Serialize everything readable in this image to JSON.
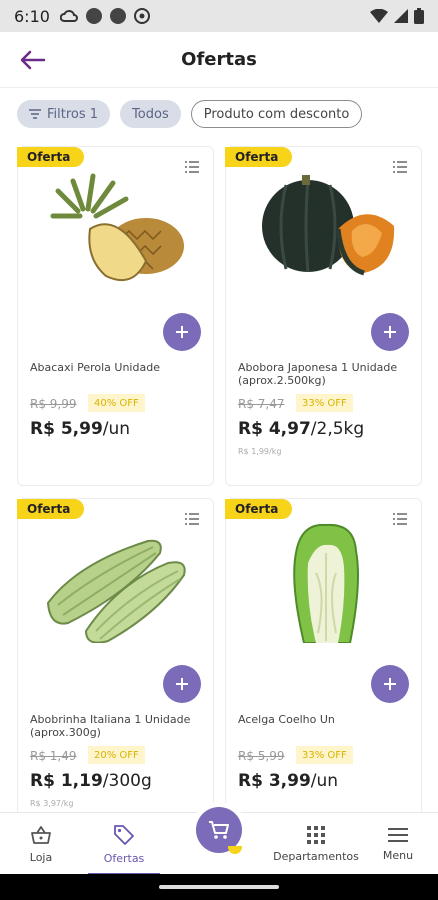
{
  "status_bar": {
    "time": "6:10"
  },
  "header": {
    "title": "Ofertas"
  },
  "filters": [
    {
      "label": "Filtros 1",
      "style": "filled"
    },
    {
      "label": "Todos",
      "style": "filled"
    },
    {
      "label": "Produto com desconto",
      "style": "outline"
    }
  ],
  "products": [
    {
      "badge": "Oferta",
      "name": "Abacaxi Perola Unidade",
      "old_price": "R$ 9,99",
      "discount": "40% OFF",
      "price": "R$ 5,99",
      "unit": "/un",
      "unit_price": ""
    },
    {
      "badge": "Oferta",
      "name": "Abobora Japonesa 1 Unidade (aprox.2.500kg)",
      "old_price": "R$ 7,47",
      "discount": "33% OFF",
      "price": "R$ 4,97",
      "unit": "/2,5kg",
      "unit_price": "R$ 1,99/kg"
    },
    {
      "badge": "Oferta",
      "name": "Abobrinha Italiana 1 Unidade (aprox.300g)",
      "old_price": "R$ 1,49",
      "discount": "20% OFF",
      "price": "R$ 1,19",
      "unit": "/300g",
      "unit_price": "R$ 3,97/kg"
    },
    {
      "badge": "Oferta",
      "name": "Acelga Coelho Un",
      "old_price": "R$ 5,99",
      "discount": "33% OFF",
      "price": "R$ 3,99",
      "unit": "/un",
      "unit_price": ""
    }
  ],
  "bottom_nav": {
    "items": [
      {
        "label": "Loja",
        "icon": "basket-icon"
      },
      {
        "label": "Ofertas",
        "icon": "tag-icon",
        "active": true
      },
      {
        "label": "Departamentos",
        "icon": "grid-icon"
      },
      {
        "label": "Menu",
        "icon": "menu-icon"
      }
    ],
    "cart_icon": "cart-icon"
  },
  "colors": {
    "accent": "#7b6bb8",
    "badge": "#f7d31a",
    "active_nav": "#6a55b0"
  }
}
